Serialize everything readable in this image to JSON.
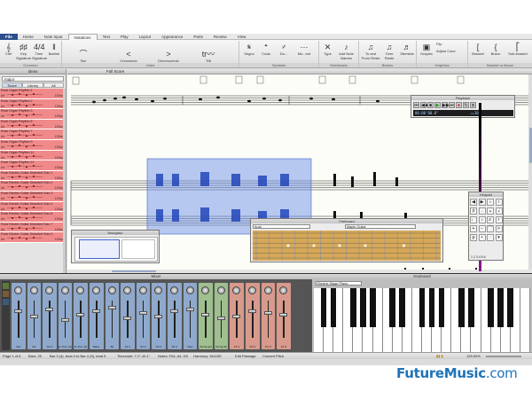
{
  "tabs": [
    "File",
    "Home",
    "Note Input",
    "Notations",
    "Text",
    "Play",
    "Layout",
    "Appearance",
    "Parts",
    "Review",
    "View"
  ],
  "active_tab": "Notations",
  "ribbon": {
    "groups": [
      {
        "label": "Common",
        "items": [
          "Clef",
          "Key Signature",
          "Time Signature",
          "Barline"
        ]
      },
      {
        "label": "Lines",
        "items": [
          "Slur",
          "Crescendo",
          "Decrescendo",
          "Trill"
        ]
      },
      {
        "label": "Symbols",
        "items": [
          "Segno",
          "Coda",
          "Do...",
          "Mo...ent"
        ]
      },
      {
        "label": "Noteheads",
        "items": [
          "Type",
          "Add Note Names"
        ]
      },
      {
        "label": "Beams",
        "items": [
          "To and From Rests",
          "Over Rests",
          "Stemlets"
        ]
      },
      {
        "label": "Graphics",
        "items": [
          "Graphic",
          "Flip",
          "Adjust Color"
        ]
      },
      {
        "label": "Bracket or Brace",
        "items": [
          "Bracket",
          "Brace",
          "Sub-bracket"
        ]
      }
    ]
  },
  "ideas_panel": {
    "title": "Ideas",
    "search_value": "major",
    "subtabs": [
      "Score",
      "Library",
      "All"
    ],
    "presets": [
      {
        "name": "Rock Organ Rhythm 1",
        "tag": "Art",
        "tempo": "120bp"
      },
      {
        "name": "Rock Organ Rhythm 2",
        "tag": "Art",
        "tempo": "120bp"
      },
      {
        "name": "Rock Organ Rhythm 3",
        "tag": "Art",
        "tempo": "120bp"
      },
      {
        "name": "Rock Organ Rhythm 5",
        "tag": "Art",
        "tempo": "120bp"
      },
      {
        "name": "Rock Organ Rhythm 7",
        "tag": "Art",
        "tempo": "120bp"
      },
      {
        "name": "Rock Organ Rhythm 9",
        "tag": "Art",
        "tempo": "120bp"
      },
      {
        "name": "Rock Organ Rhythm 11",
        "tag": "Art",
        "tempo": "120bp"
      },
      {
        "name": "Rock Organ Rhythm 12",
        "tag": "Art",
        "tempo": "120bp"
      },
      {
        "name": "Rock Electric Guitar Distorted Solo 1",
        "tag": "Art",
        "tempo": "120bp"
      },
      {
        "name": "Rock Electric Guitar Distorted Solo 2",
        "tag": "Art",
        "tempo": "120bp"
      },
      {
        "name": "Rock Electric Guitar Distorted Solo 3",
        "tag": "Art",
        "tempo": "120bp"
      },
      {
        "name": "Rock Electric Guitar Distorted Solo 4",
        "tag": "Art",
        "tempo": "120bp"
      },
      {
        "name": "Rock Electric Guitar Distorted Solo 6",
        "tag": "Art",
        "tempo": "120bp"
      },
      {
        "name": "Rock Electric Guitar Distorted Solo 7",
        "tag": "Art",
        "tempo": "120bp"
      },
      {
        "name": "Rock Electric Guitar Distorted Solo 9",
        "tag": "Art",
        "tempo": "120bp"
      }
    ]
  },
  "score_title": "Full Score",
  "playback": {
    "title": "Playback",
    "time": "00:00'00.0\"",
    "tempo": "♩=100"
  },
  "keypad": {
    "title": "Keypad",
    "footer": "1 2 3 4 5 6"
  },
  "navigator": {
    "title": "Navigator"
  },
  "fretboard": {
    "title": "Fretboard",
    "mode": "Auto",
    "instrument": "Maple Guitar"
  },
  "mixer": {
    "title": "Mixer",
    "channels": [
      {
        "name": "Vox",
        "color": "#8fa9cc"
      },
      {
        "name": "Gtr",
        "color": "#8fa9cc"
      },
      {
        "name": "Gtr 2",
        "color": "#8fa9cc"
      },
      {
        "name": "E. Pno. (d)",
        "color": "#8fa9cc"
      },
      {
        "name": "E. Pno. (b)",
        "color": "#8fa9cc"
      },
      {
        "name": "Bass",
        "color": "#8fa9cc"
      },
      {
        "name": "Bs",
        "color": "#8fa9cc"
      },
      {
        "name": "Kit 1",
        "color": "#8fa9cc"
      },
      {
        "name": "Kit 2",
        "color": "#8fa9cc"
      },
      {
        "name": "Kit 3",
        "color": "#8fa9cc"
      },
      {
        "name": "Kit 4",
        "color": "#8fa9cc"
      },
      {
        "name": "Clav",
        "color": "#8fa9cc"
      },
      {
        "name": "Vst Sound",
        "color": "#9fbf8f"
      },
      {
        "name": "Vst Synth",
        "color": "#9fbf8f"
      },
      {
        "name": "FX 1",
        "color": "#d89a8c"
      },
      {
        "name": "FX 2",
        "color": "#d89a8c"
      },
      {
        "name": "FX 3",
        "color": "#d89a8c"
      },
      {
        "name": "FX 4",
        "color": "#d89a8c"
      }
    ],
    "master": "Master"
  },
  "keyboard": {
    "title": "Keyboard",
    "instrument": "Electric Stage Piano"
  },
  "status": {
    "page": "Page 1 of 6",
    "bars": "Bars: 25",
    "position": "Bar 3 (4), beat 4 to Bar 4 (5), beat 5",
    "timecode": "Timecode: 7.2\"-10.1\"",
    "notes": "Notes: F#4, A4, D5",
    "harmony": "Harmony: Db13/E",
    "mode": "Edit Passage",
    "pitch": "Concert Pitch",
    "zoom": "125.00%"
  },
  "watermark": {
    "brand": "FutureMusic",
    "domain": ".com"
  },
  "colors": {
    "file_tab": "#2b4f8c",
    "idea_tile": "#f08a8a",
    "selection": "#6f93e6",
    "playback_bar": "#8a1a8a"
  }
}
